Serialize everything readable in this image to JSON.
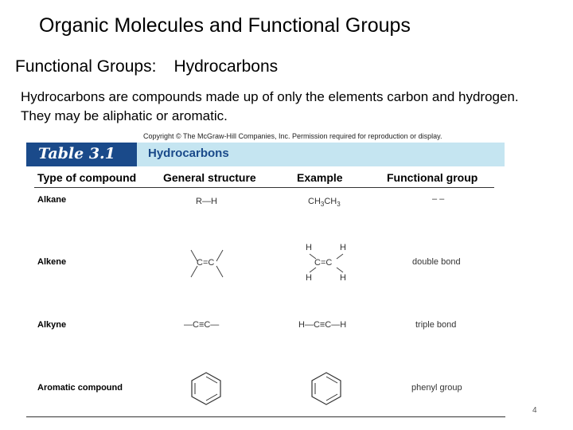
{
  "title": "Organic Molecules and Functional Groups",
  "subtitle": {
    "part1": "Functional Groups:",
    "part2": "Hydrocarbons"
  },
  "body": "Hydrocarbons are compounds made up of only the elements carbon and hydrogen.  They may be aliphatic or aromatic.",
  "table": {
    "copyright": "Copyright © The McGraw-Hill Companies, Inc. Permission required for reproduction or display.",
    "tag": "Table 3.1",
    "name": "Hydrocarbons",
    "columns": [
      "Type of compound",
      "General structure",
      "Example",
      "Functional group"
    ],
    "rows": [
      {
        "type": "Alkane",
        "general": "R—H",
        "example": "CH3CH3",
        "functional_group": "– –"
      },
      {
        "type": "Alkene",
        "general": "C=C",
        "example": "C=C",
        "functional_group": "double bond"
      },
      {
        "type": "Alkyne",
        "general": "—C≡C—",
        "example": "H—C≡C—H",
        "functional_group": "triple bond"
      },
      {
        "type": "Aromatic compound",
        "general": "benzene-ring",
        "example": "benzene-ring",
        "functional_group": "phenyl group"
      }
    ]
  },
  "page_number": "4"
}
